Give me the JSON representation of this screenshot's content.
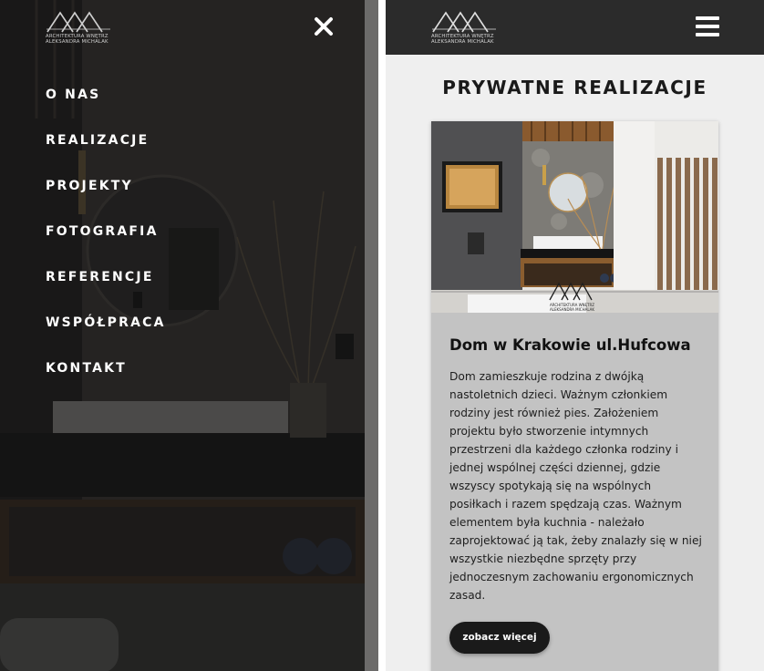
{
  "logo": {
    "line1": "ARCHITEKTURA WNĘTRZ",
    "line2": "ALEKSANDRA MICHALAK"
  },
  "menu": {
    "items": [
      {
        "label": "O NAS"
      },
      {
        "label": "REALIZACJE"
      },
      {
        "label": "PROJEKTY"
      },
      {
        "label": "FOTOGRAFIA"
      },
      {
        "label": "REFERENCJE"
      },
      {
        "label": "WSPÓŁPRACA"
      },
      {
        "label": "KONTAKT"
      }
    ]
  },
  "icons": {
    "close": "close-icon",
    "menu": "hamburger-menu-icon"
  },
  "page": {
    "heading": "PRYWATNE REALIZACJE"
  },
  "card": {
    "title": "Dom w Krakowie ul.Hufcowa",
    "description": "Dom zamieszkuje rodzina z dwójką nastoletnich dzieci. Ważnym członkiem rodziny jest również pies. Założeniem projektu było stworzenie intymnych przestrzeni dla każdego członka rodziny i jednej wspólnej części dziennej, gdzie wszyscy spotykają się na wspólnych posiłkach i razem spędzają czas. Ważnym elementem była kuchnia - należało zaprojektować ją tak, żeby znalazły się w niej wszystkie niezbędne sprzęty przy jednoczesnym zachowaniu ergonomicznych zasad.",
    "button_label": "zobacz więcej"
  },
  "colors": {
    "topbar": "#2b2b2b",
    "page_background": "#efefef",
    "card_background": "#c3c3c3",
    "button_background": "#1a1a1a",
    "menu_overlay": "#1c1c1c"
  }
}
